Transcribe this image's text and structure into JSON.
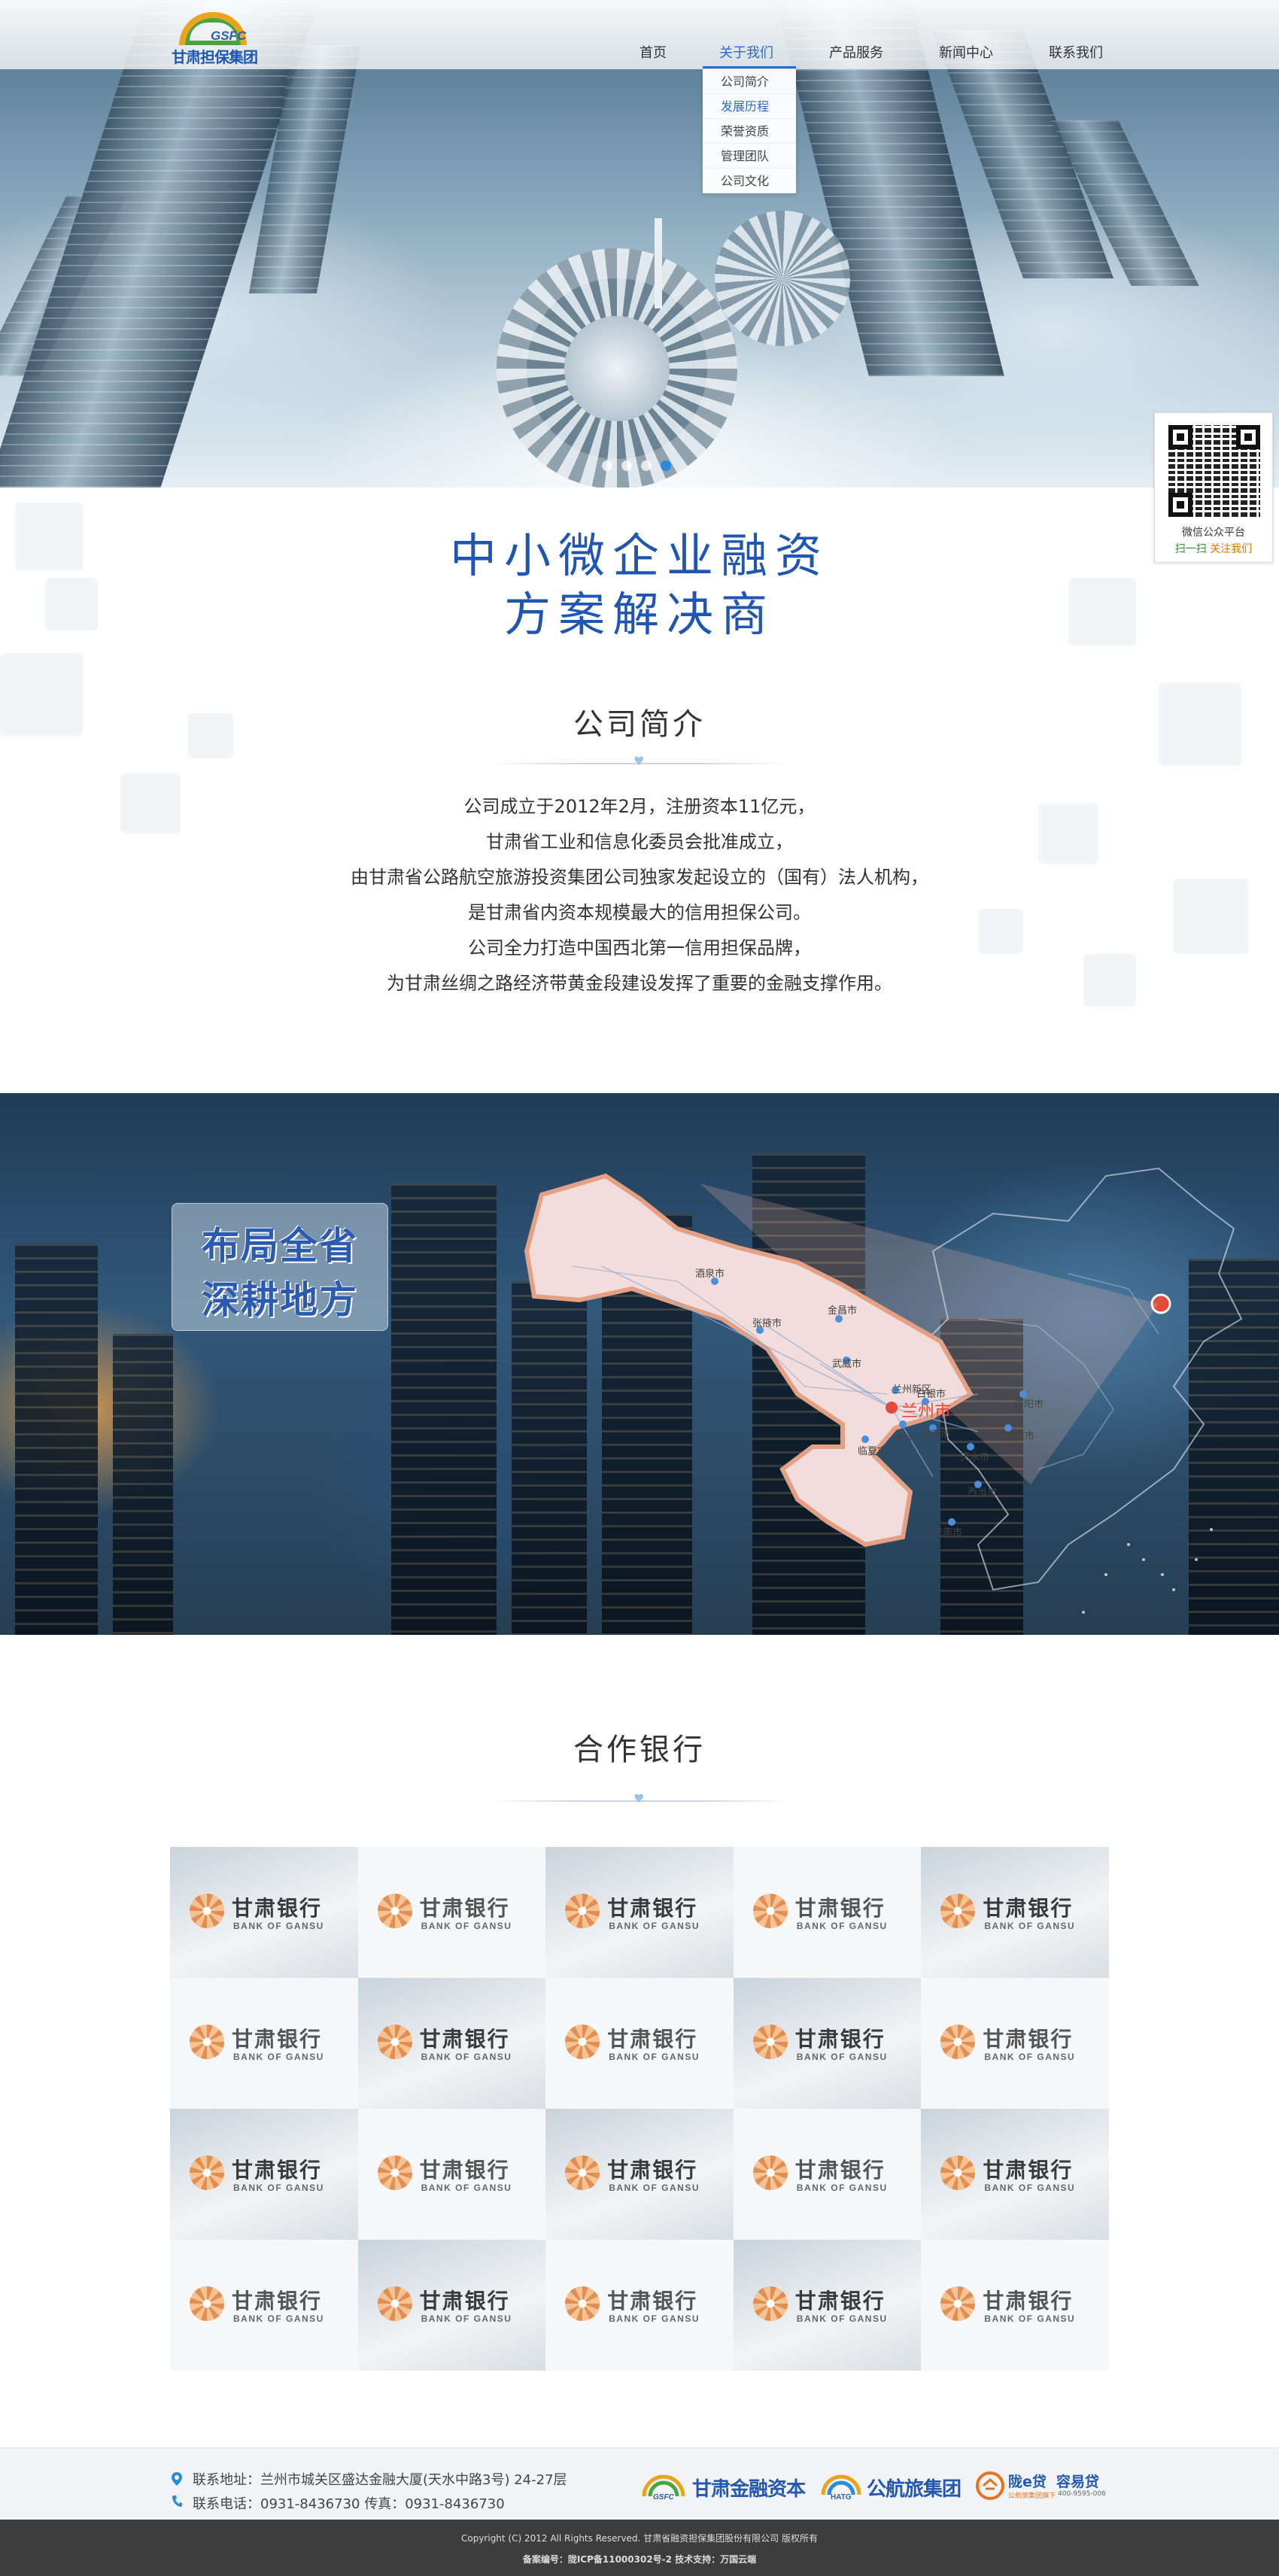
{
  "header": {
    "logo": {
      "abbr": "GSFC",
      "name": "甘肃担保集团"
    },
    "nav": [
      {
        "label": "首页"
      },
      {
        "label": "关于我们"
      },
      {
        "label": "产品服务"
      },
      {
        "label": "新闻中心"
      },
      {
        "label": "联系我们"
      }
    ],
    "active_nav": "关于我们",
    "dropdown": [
      {
        "label": "公司简介"
      },
      {
        "label": "发展历程"
      },
      {
        "label": "荣誉资质"
      },
      {
        "label": "管理团队"
      },
      {
        "label": "公司文化"
      }
    ],
    "dropdown_highlight": "发展历程"
  },
  "slider": {
    "slides": 4,
    "current": 4
  },
  "qr_panel": {
    "title": "微信公众平台",
    "scan": "扫一扫",
    "follow": "关注我们"
  },
  "intro": {
    "slogan_line1": "中小微企业融资",
    "slogan_line2": "方案解决商",
    "section_title": "公司简介",
    "paragraphs": [
      "公司成立于2012年2月，注册资本11亿元，",
      "甘肃省工业和信息化委员会批准成立，",
      "由甘肃省公路航空旅游投资集团公司独家发起设立的（国有）法人机构，",
      "是甘肃省内资本规模最大的信用担保公司。",
      "公司全力打造中国西北第一信用担保品牌，",
      "为甘肃丝绸之路经济带黄金段建设发挥了重要的金融支撑作用。"
    ]
  },
  "map_band": {
    "badge_line1": "布局全省",
    "badge_line2": "深耕地方",
    "cities": [
      "酒泉市",
      "张掖市",
      "金昌市",
      "武威市",
      "兰州新区",
      "兰州市",
      "白银市",
      "定西市",
      "临夏市",
      "榆中",
      "天水市",
      "平凉市",
      "庆阳市",
      "西当市",
      "陇南市"
    ],
    "capital": "兰州市"
  },
  "banks": {
    "section_title": "合作银行",
    "tiles": [
      {
        "name": "甘肃银行",
        "en": "BANK OF GANSU"
      },
      {
        "name": "甘肃银行",
        "en": "BANK OF GANSU"
      },
      {
        "name": "甘肃银行",
        "en": "BANK OF GANSU"
      },
      {
        "name": "甘肃银行",
        "en": "BANK OF GANSU"
      },
      {
        "name": "甘肃银行",
        "en": "BANK OF GANSU"
      },
      {
        "name": "甘肃银行",
        "en": "BANK OF GANSU"
      },
      {
        "name": "甘肃银行",
        "en": "BANK OF GANSU"
      },
      {
        "name": "甘肃银行",
        "en": "BANK OF GANSU"
      },
      {
        "name": "甘肃银行",
        "en": "BANK OF GANSU"
      },
      {
        "name": "甘肃银行",
        "en": "BANK OF GANSU"
      },
      {
        "name": "甘肃银行",
        "en": "BANK OF GANSU"
      },
      {
        "name": "甘肃银行",
        "en": "BANK OF GANSU"
      },
      {
        "name": "甘肃银行",
        "en": "BANK OF GANSU"
      },
      {
        "name": "甘肃银行",
        "en": "BANK OF GANSU"
      },
      {
        "name": "甘肃银行",
        "en": "BANK OF GANSU"
      },
      {
        "name": "甘肃银行",
        "en": "BANK OF GANSU"
      },
      {
        "name": "甘肃银行",
        "en": "BANK OF GANSU"
      },
      {
        "name": "甘肃银行",
        "en": "BANK OF GANSU"
      },
      {
        "name": "甘肃银行",
        "en": "BANK OF GANSU"
      },
      {
        "name": "甘肃银行",
        "en": "BANK OF GANSU"
      }
    ]
  },
  "footer": {
    "address": "联系地址：兰州市城关区盛达金融大厦(天水中路3号) 24-27层",
    "phone": "联系电话：0931-8436730 传真：0931-8436730",
    "partners": [
      {
        "abbr": "GSFC",
        "name": "甘肃金融资本",
        "icon": "rainbow-logo-icon"
      },
      {
        "abbr": "HATG",
        "name": "公航旅集团",
        "icon": "rainbow-logo-icon"
      },
      {
        "name": "陇e贷",
        "name2": "容易贷",
        "sub": "公航旅集团旗下",
        "phone": "400-9595-006",
        "icon": "eloan-logo-icon"
      }
    ],
    "copyright": "Copyright (C) 2012 All Rights Reserved.          甘肃省融资担保集团股份有限公司 版权所有",
    "icp": "备案编号：陇ICP备11000302号-2    技术支持：万国云端"
  },
  "colors": {
    "brand_blue": "#2056b3",
    "nav_active": "#2a6ac9",
    "footer_dark": "#3d3d3d"
  }
}
